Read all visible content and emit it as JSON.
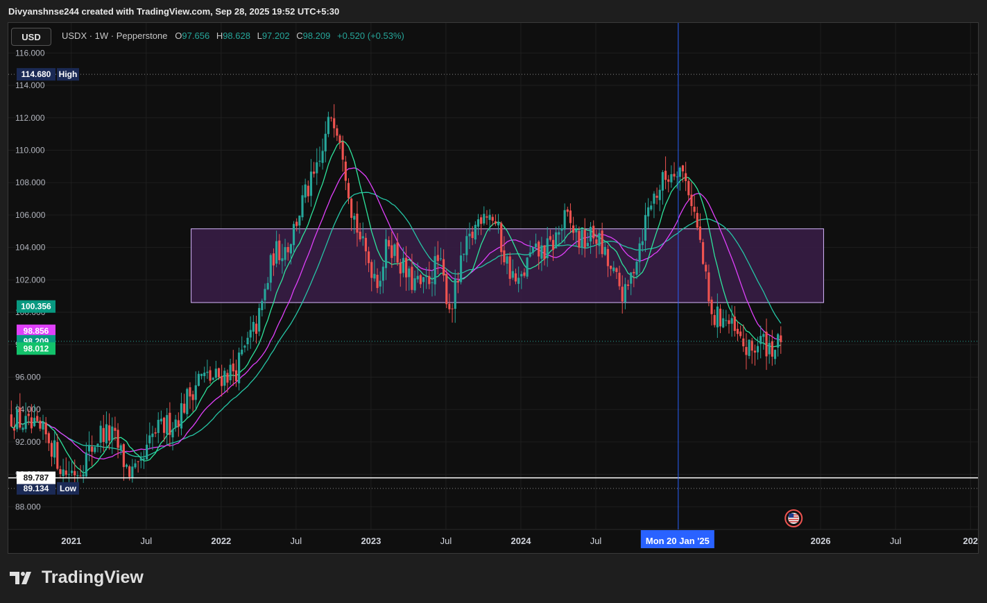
{
  "header": {
    "attribution": "Divyanshnse244 created with TradingView.com, Sep 28, 2025 19:52 UTC+5:30"
  },
  "symbol_button": {
    "label": "USD"
  },
  "legend": {
    "symbol": "USDX · 1W · Pepperstone",
    "o_key": "O",
    "o_val": "97.656",
    "h_key": "H",
    "h_val": "98.628",
    "l_key": "L",
    "l_val": "97.202",
    "c_key": "C",
    "c_val": "98.209",
    "change": "+0.520 (+0.53%)"
  },
  "footer": {
    "brand": "TradingView"
  },
  "colors": {
    "up": "#26a69a",
    "down": "#ef5350",
    "ma_fast": "#2ee59d",
    "ma_mid": "#e040fb",
    "ma_slow": "#26c6a6",
    "zone_fill": "#3a1d48",
    "zone_stroke": "#d8b8ff",
    "crosshair": "#2962ff"
  },
  "chart_data": {
    "type": "candlestick",
    "title": "USDX · 1W · Pepperstone",
    "ylim": [
      86.6,
      116.4
    ],
    "y_ticks": [
      "116.000",
      "114.000",
      "112.000",
      "110.000",
      "108.000",
      "106.000",
      "104.000",
      "102.000",
      "100.000",
      "98.000",
      "96.000",
      "94.000",
      "92.000",
      "90.000",
      "88.000"
    ],
    "x_ticks": [
      {
        "label": "2021",
        "t": 2021.0,
        "bold": true
      },
      {
        "label": "Jul",
        "t": 2021.5,
        "bold": false
      },
      {
        "label": "2022",
        "t": 2022.0,
        "bold": true
      },
      {
        "label": "Jul",
        "t": 2022.5,
        "bold": false
      },
      {
        "label": "2023",
        "t": 2023.0,
        "bold": true
      },
      {
        "label": "Jul",
        "t": 2023.5,
        "bold": false
      },
      {
        "label": "2024",
        "t": 2024.0,
        "bold": true
      },
      {
        "label": "Jul",
        "t": 2024.5,
        "bold": false
      },
      {
        "label": "2026",
        "t": 2026.0,
        "bold": true
      },
      {
        "label": "Jul",
        "t": 2026.5,
        "bold": false
      },
      {
        "label": "202",
        "t": 2027.0,
        "bold": true
      }
    ],
    "x_range": [
      2020.58,
      2027.05
    ],
    "price_path": [
      [
        2020.6,
        93.6
      ],
      [
        2020.7,
        93.0
      ],
      [
        2020.85,
        92.2
      ],
      [
        2020.95,
        90.1
      ],
      [
        2021.05,
        90.3
      ],
      [
        2021.2,
        92.6
      ],
      [
        2021.28,
        92.3
      ],
      [
        2021.38,
        90.2
      ],
      [
        2021.45,
        90.0
      ],
      [
        2021.55,
        92.5
      ],
      [
        2021.7,
        93.4
      ],
      [
        2021.85,
        96.0
      ],
      [
        2021.95,
        95.9
      ],
      [
        2022.1,
        96.5
      ],
      [
        2022.25,
        99.5
      ],
      [
        2022.35,
        103.6
      ],
      [
        2022.45,
        104.2
      ],
      [
        2022.55,
        107.0
      ],
      [
        2022.65,
        108.8
      ],
      [
        2022.74,
        112.5
      ],
      [
        2022.8,
        110.8
      ],
      [
        2022.87,
        106.5
      ],
      [
        2022.95,
        103.8
      ],
      [
        2023.05,
        102.0
      ],
      [
        2023.12,
        104.5
      ],
      [
        2023.25,
        102.0
      ],
      [
        2023.35,
        101.5
      ],
      [
        2023.45,
        103.2
      ],
      [
        2023.53,
        100.2
      ],
      [
        2023.62,
        103.5
      ],
      [
        2023.75,
        106.5
      ],
      [
        2023.82,
        105.8
      ],
      [
        2023.9,
        103.2
      ],
      [
        2023.98,
        101.5
      ],
      [
        2024.06,
        103.4
      ],
      [
        2024.2,
        104.0
      ],
      [
        2024.3,
        105.8
      ],
      [
        2024.4,
        104.3
      ],
      [
        2024.5,
        104.8
      ],
      [
        2024.6,
        102.5
      ],
      [
        2024.7,
        100.9
      ],
      [
        2024.78,
        103.9
      ],
      [
        2024.86,
        106.7
      ],
      [
        2024.95,
        108.1
      ],
      [
        2025.05,
        109.2
      ],
      [
        2025.13,
        107.4
      ],
      [
        2025.2,
        104.0
      ],
      [
        2025.27,
        99.5
      ],
      [
        2025.35,
        99.8
      ],
      [
        2025.45,
        98.3
      ],
      [
        2025.52,
        97.5
      ],
      [
        2025.6,
        98.2
      ],
      [
        2025.7,
        97.8
      ],
      [
        2025.74,
        98.209
      ]
    ],
    "ma_periods": {
      "fast": 10,
      "mid": 20,
      "slow": 30
    },
    "zone": {
      "t0": 2021.8,
      "t1": 2026.02,
      "top": 105.15,
      "bottom": 100.6
    },
    "levels": {
      "high": {
        "value": 114.68,
        "label": "114.680",
        "tag": "High"
      },
      "low": {
        "value": 89.134,
        "label": "89.134",
        "tag": "Low"
      },
      "hline": {
        "value": 89.787,
        "label": "89.787"
      },
      "last": {
        "value": 98.209,
        "label": "98.209"
      },
      "ma_slow_last": {
        "value": 100.356,
        "label": "100.356"
      },
      "ma_mid_last": {
        "value": 98.856,
        "label": "98.856"
      },
      "ma_fast_last": {
        "value": 98.012,
        "label": "98.012"
      }
    },
    "crosshair": {
      "t": 2025.05,
      "label": "Mon 20 Jan '25"
    }
  }
}
